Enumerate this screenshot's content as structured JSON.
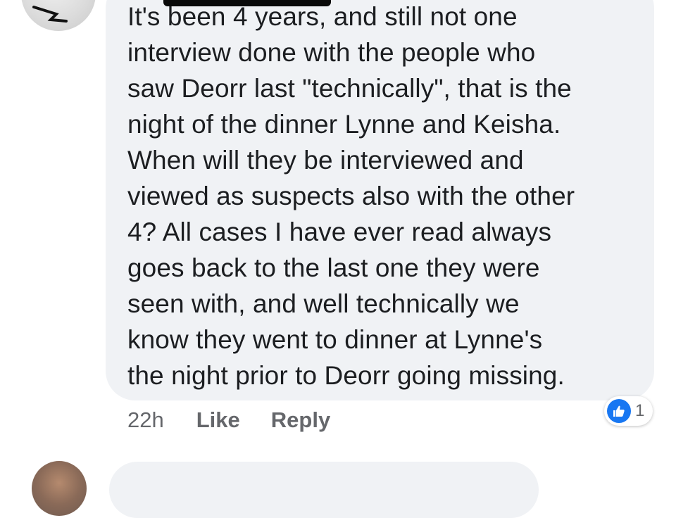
{
  "comment": {
    "text": "It's been 4 years, and still not one\ninterview done with the people who\nsaw Deorr last \"technically\", that is the\nnight of the dinner Lynne and Keisha.\nWhen will they be interviewed and\nviewed as suspects also with the other\n4?  All cases I have ever read always\ngoes back to the last one they were\nseen with, and well technically we\nknow they went to dinner at Lynne's\nthe night prior to Deorr going missing.",
    "timestamp": "22h",
    "like_label": "Like",
    "reply_label": "Reply",
    "reaction_count": "1",
    "reaction_icon": "thumbs-up-icon"
  },
  "colors": {
    "bubble": "#f0f2f5",
    "text": "#1c1e21",
    "secondary_text": "#65676b",
    "like_blue": "#1877f2"
  }
}
